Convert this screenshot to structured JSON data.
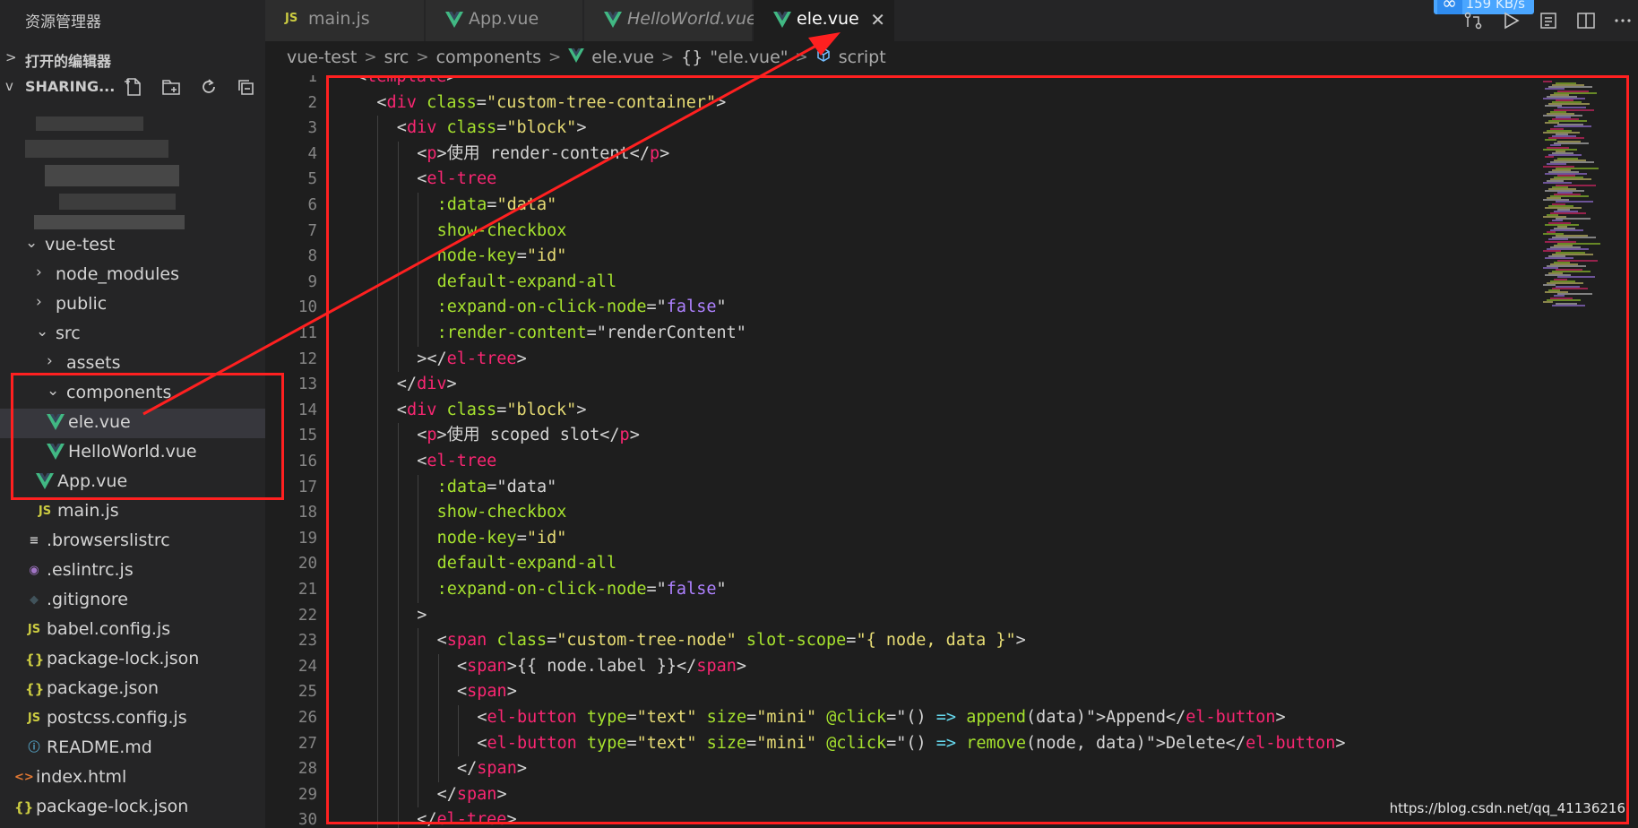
{
  "sidebar": {
    "title": "资源管理器",
    "open_editors_label": "打开的编辑器",
    "workspace_label": "SHARING...",
    "tree": [
      {
        "label": "vue-test",
        "indent": 28,
        "chevron": "v",
        "icon": ""
      },
      {
        "label": "node_modules",
        "indent": 40,
        "chevron": ">",
        "icon": ""
      },
      {
        "label": "public",
        "indent": 40,
        "chevron": ">",
        "icon": ""
      },
      {
        "label": "src",
        "indent": 40,
        "chevron": "v",
        "icon": ""
      },
      {
        "label": "assets",
        "indent": 52,
        "chevron": ">",
        "icon": ""
      },
      {
        "label": "components",
        "indent": 52,
        "chevron": "v",
        "icon": ""
      },
      {
        "label": "ele.vue",
        "indent": 64,
        "chevron": "",
        "icon": "vue",
        "selected": true
      },
      {
        "label": "HelloWorld.vue",
        "indent": 64,
        "chevron": "",
        "icon": "vue"
      },
      {
        "label": "App.vue",
        "indent": 52,
        "chevron": "",
        "icon": "vue"
      },
      {
        "label": "main.js",
        "indent": 52,
        "chevron": "",
        "icon": "js"
      },
      {
        "label": ".browserslistrc",
        "indent": 40,
        "chevron": "",
        "icon": "lines"
      },
      {
        "label": ".eslintrc.js",
        "indent": 40,
        "chevron": "",
        "icon": "eslint"
      },
      {
        "label": ".gitignore",
        "indent": 40,
        "chevron": "",
        "icon": "git"
      },
      {
        "label": "babel.config.js",
        "indent": 40,
        "chevron": "",
        "icon": "js"
      },
      {
        "label": "package-lock.json",
        "indent": 40,
        "chevron": "",
        "icon": "json"
      },
      {
        "label": "package.json",
        "indent": 40,
        "chevron": "",
        "icon": "json"
      },
      {
        "label": "postcss.config.js",
        "indent": 40,
        "chevron": "",
        "icon": "js"
      },
      {
        "label": "README.md",
        "indent": 40,
        "chevron": "",
        "icon": "info"
      },
      {
        "label": "index.html",
        "indent": 28,
        "chevron": "",
        "icon": "html"
      },
      {
        "label": "package-lock.json",
        "indent": 28,
        "chevron": "",
        "icon": "json"
      }
    ]
  },
  "tabs": [
    {
      "label": "main.js",
      "icon": "js",
      "active": false,
      "italic": false
    },
    {
      "label": "App.vue",
      "icon": "vue",
      "active": false,
      "italic": false
    },
    {
      "label": "HelloWorld.vue",
      "icon": "vue",
      "active": false,
      "italic": true
    },
    {
      "label": "ele.vue",
      "icon": "vue",
      "active": true,
      "italic": false,
      "close": "✕"
    }
  ],
  "speed_badge": "159 KB/s",
  "breadcrumb": {
    "items": [
      "vue-test",
      "src",
      "components"
    ],
    "file": "ele.vue",
    "symbol": "\"ele.vue\"",
    "symbol_prefix": "{}",
    "last": "script",
    "separator": ">"
  },
  "editor": {
    "first_line_number": 1,
    "lines": [
      [
        [
          0,
          ""
        ],
        [
          "p",
          "<"
        ],
        [
          "t",
          "template"
        ],
        [
          "p",
          ">"
        ]
      ],
      [
        [
          2,
          ""
        ],
        [
          "p",
          "<"
        ],
        [
          "t",
          "div"
        ],
        [
          "p",
          " "
        ],
        [
          "a",
          "class"
        ],
        [
          "p",
          "="
        ],
        [
          "s",
          "\"custom-tree-container\""
        ],
        [
          "p",
          ">"
        ]
      ],
      [
        [
          4,
          ""
        ],
        [
          "p",
          "<"
        ],
        [
          "t",
          "div"
        ],
        [
          "p",
          " "
        ],
        [
          "a",
          "class"
        ],
        [
          "p",
          "="
        ],
        [
          "s",
          "\"block\""
        ],
        [
          "p",
          ">"
        ]
      ],
      [
        [
          6,
          ""
        ],
        [
          "p",
          "<"
        ],
        [
          "t",
          "p"
        ],
        [
          "p",
          ">使用 render-content</"
        ],
        [
          "t",
          "p"
        ],
        [
          "p",
          ">"
        ]
      ],
      [
        [
          6,
          ""
        ],
        [
          "p",
          "<"
        ],
        [
          "t",
          "el-tree"
        ]
      ],
      [
        [
          8,
          ""
        ],
        [
          "a",
          ":data"
        ],
        [
          "p",
          "="
        ],
        [
          "s",
          "\"data\""
        ]
      ],
      [
        [
          8,
          ""
        ],
        [
          "a",
          "show-checkbox"
        ]
      ],
      [
        [
          8,
          ""
        ],
        [
          "a",
          "node-key"
        ],
        [
          "p",
          "="
        ],
        [
          "s",
          "\"id\""
        ]
      ],
      [
        [
          8,
          ""
        ],
        [
          "a",
          "default-expand-all"
        ]
      ],
      [
        [
          8,
          ""
        ],
        [
          "a",
          ":expand-on-click-node"
        ],
        [
          "p",
          "=\""
        ],
        [
          "k",
          "false"
        ],
        [
          "p",
          "\""
        ]
      ],
      [
        [
          8,
          ""
        ],
        [
          "a",
          ":render-content"
        ],
        [
          "p",
          "=\"renderContent\""
        ]
      ],
      [
        [
          6,
          ""
        ],
        [
          "p",
          "></"
        ],
        [
          "t",
          "el-tree"
        ],
        [
          "p",
          ">"
        ]
      ],
      [
        [
          4,
          ""
        ],
        [
          "p",
          "</"
        ],
        [
          "t",
          "div"
        ],
        [
          "p",
          ">"
        ]
      ],
      [
        [
          4,
          ""
        ],
        [
          "p",
          "<"
        ],
        [
          "t",
          "div"
        ],
        [
          "p",
          " "
        ],
        [
          "a",
          "class"
        ],
        [
          "p",
          "="
        ],
        [
          "s",
          "\"block\""
        ],
        [
          "p",
          ">"
        ]
      ],
      [
        [
          6,
          ""
        ],
        [
          "p",
          "<"
        ],
        [
          "t",
          "p"
        ],
        [
          "p",
          ">使用 scoped slot</"
        ],
        [
          "t",
          "p"
        ],
        [
          "p",
          ">"
        ]
      ],
      [
        [
          6,
          ""
        ],
        [
          "p",
          "<"
        ],
        [
          "t",
          "el-tree"
        ]
      ],
      [
        [
          8,
          ""
        ],
        [
          "a",
          ":data"
        ],
        [
          "p",
          "=\"data\""
        ]
      ],
      [
        [
          8,
          ""
        ],
        [
          "a",
          "show-checkbox"
        ]
      ],
      [
        [
          8,
          ""
        ],
        [
          "a",
          "node-key"
        ],
        [
          "p",
          "="
        ],
        [
          "s",
          "\"id\""
        ]
      ],
      [
        [
          8,
          ""
        ],
        [
          "a",
          "default-expand-all"
        ]
      ],
      [
        [
          8,
          ""
        ],
        [
          "a",
          ":expand-on-click-node"
        ],
        [
          "p",
          "=\""
        ],
        [
          "k",
          "false"
        ],
        [
          "p",
          "\""
        ]
      ],
      [
        [
          6,
          ""
        ],
        [
          "p",
          ">"
        ]
      ],
      [
        [
          8,
          ""
        ],
        [
          "p",
          "<"
        ],
        [
          "t",
          "span"
        ],
        [
          "p",
          " "
        ],
        [
          "a",
          "class"
        ],
        [
          "p",
          "="
        ],
        [
          "s",
          "\"custom-tree-node\""
        ],
        [
          "p",
          " "
        ],
        [
          "a",
          "slot-scope"
        ],
        [
          "p",
          "="
        ],
        [
          "s",
          "\"{ node, data }\""
        ],
        [
          "p",
          ">"
        ]
      ],
      [
        [
          10,
          ""
        ],
        [
          "p",
          "<"
        ],
        [
          "t",
          "span"
        ],
        [
          "p",
          ">{{ node.label }}</"
        ],
        [
          "t",
          "span"
        ],
        [
          "p",
          ">"
        ]
      ],
      [
        [
          10,
          ""
        ],
        [
          "p",
          "<"
        ],
        [
          "t",
          "span"
        ],
        [
          "p",
          ">"
        ]
      ],
      [
        [
          12,
          ""
        ],
        [
          "p",
          "<"
        ],
        [
          "t",
          "el-button"
        ],
        [
          "p",
          " "
        ],
        [
          "a",
          "type"
        ],
        [
          "p",
          "="
        ],
        [
          "s",
          "\"text\""
        ],
        [
          "p",
          " "
        ],
        [
          "a",
          "size"
        ],
        [
          "p",
          "="
        ],
        [
          "s",
          "\"mini\""
        ],
        [
          "p",
          " "
        ],
        [
          "a",
          "@click"
        ],
        [
          "p",
          "=\"() "
        ],
        [
          "o",
          "=>"
        ],
        [
          "p",
          " "
        ],
        [
          "f",
          "append"
        ],
        [
          "p",
          "(data)\">Append</"
        ],
        [
          "t",
          "el-button"
        ],
        [
          "p",
          ">"
        ]
      ],
      [
        [
          12,
          ""
        ],
        [
          "p",
          "<"
        ],
        [
          "t",
          "el-button"
        ],
        [
          "p",
          " "
        ],
        [
          "a",
          "type"
        ],
        [
          "p",
          "="
        ],
        [
          "s",
          "\"text\""
        ],
        [
          "p",
          " "
        ],
        [
          "a",
          "size"
        ],
        [
          "p",
          "="
        ],
        [
          "s",
          "\"mini\""
        ],
        [
          "p",
          " "
        ],
        [
          "a",
          "@click"
        ],
        [
          "p",
          "=\"() "
        ],
        [
          "o",
          "=>"
        ],
        [
          "p",
          " "
        ],
        [
          "f",
          "remove"
        ],
        [
          "p",
          "(node, data)\">Delete</"
        ],
        [
          "t",
          "el-button"
        ],
        [
          "p",
          ">"
        ]
      ],
      [
        [
          10,
          ""
        ],
        [
          "p",
          "</"
        ],
        [
          "t",
          "span"
        ],
        [
          "p",
          ">"
        ]
      ],
      [
        [
          8,
          ""
        ],
        [
          "p",
          "</"
        ],
        [
          "t",
          "span"
        ],
        [
          "p",
          ">"
        ]
      ],
      [
        [
          6,
          ""
        ],
        [
          "p",
          "</"
        ],
        [
          "t",
          "el-tree"
        ],
        [
          "p",
          ">"
        ]
      ]
    ]
  },
  "watermark": "https://blog.csdn.net/qq_41136216",
  "colors": {
    "annotation_red": "#ff2020",
    "vue_green": "#41b883",
    "js_yellow": "#cbcb41"
  }
}
